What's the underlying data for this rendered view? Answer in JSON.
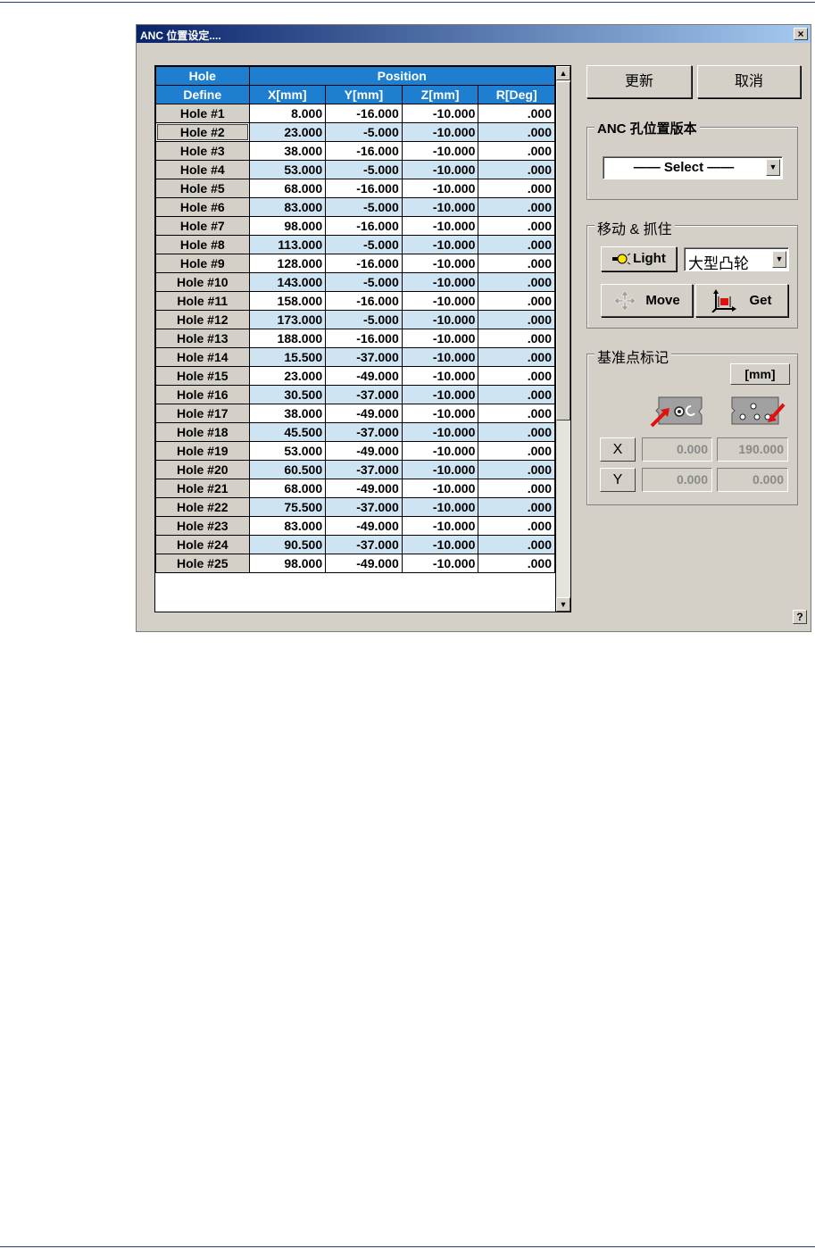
{
  "window": {
    "title": "ANC 位置设定....",
    "close_glyph": "×"
  },
  "grid": {
    "header_top": {
      "hole": "Hole",
      "position": "Position"
    },
    "header_cols": [
      "Define",
      "X[mm]",
      "Y[mm]",
      "Z[mm]",
      "R[Deg]"
    ],
    "rows": [
      [
        "Hole #1",
        "8.000",
        "-16.000",
        "-10.000",
        ".000"
      ],
      [
        "Hole #2",
        "23.000",
        "-5.000",
        "-10.000",
        ".000"
      ],
      [
        "Hole #3",
        "38.000",
        "-16.000",
        "-10.000",
        ".000"
      ],
      [
        "Hole #4",
        "53.000",
        "-5.000",
        "-10.000",
        ".000"
      ],
      [
        "Hole #5",
        "68.000",
        "-16.000",
        "-10.000",
        ".000"
      ],
      [
        "Hole #6",
        "83.000",
        "-5.000",
        "-10.000",
        ".000"
      ],
      [
        "Hole #7",
        "98.000",
        "-16.000",
        "-10.000",
        ".000"
      ],
      [
        "Hole #8",
        "113.000",
        "-5.000",
        "-10.000",
        ".000"
      ],
      [
        "Hole #9",
        "128.000",
        "-16.000",
        "-10.000",
        ".000"
      ],
      [
        "Hole #10",
        "143.000",
        "-5.000",
        "-10.000",
        ".000"
      ],
      [
        "Hole #11",
        "158.000",
        "-16.000",
        "-10.000",
        ".000"
      ],
      [
        "Hole #12",
        "173.000",
        "-5.000",
        "-10.000",
        ".000"
      ],
      [
        "Hole #13",
        "188.000",
        "-16.000",
        "-10.000",
        ".000"
      ],
      [
        "Hole #14",
        "15.500",
        "-37.000",
        "-10.000",
        ".000"
      ],
      [
        "Hole #15",
        "23.000",
        "-49.000",
        "-10.000",
        ".000"
      ],
      [
        "Hole #16",
        "30.500",
        "-37.000",
        "-10.000",
        ".000"
      ],
      [
        "Hole #17",
        "38.000",
        "-49.000",
        "-10.000",
        ".000"
      ],
      [
        "Hole #18",
        "45.500",
        "-37.000",
        "-10.000",
        ".000"
      ],
      [
        "Hole #19",
        "53.000",
        "-49.000",
        "-10.000",
        ".000"
      ],
      [
        "Hole #20",
        "60.500",
        "-37.000",
        "-10.000",
        ".000"
      ],
      [
        "Hole #21",
        "68.000",
        "-49.000",
        "-10.000",
        ".000"
      ],
      [
        "Hole #22",
        "75.500",
        "-37.000",
        "-10.000",
        ".000"
      ],
      [
        "Hole #23",
        "83.000",
        "-49.000",
        "-10.000",
        ".000"
      ],
      [
        "Hole #24",
        "90.500",
        "-37.000",
        "-10.000",
        ".000"
      ],
      [
        "Hole #25",
        "98.000",
        "-49.000",
        "-10.000",
        ".000"
      ]
    ],
    "selected_row": "Hole #2"
  },
  "buttons": {
    "update": "更新",
    "cancel": "取消"
  },
  "version_group": {
    "legend": "ANC 孔位置版本",
    "select_value": "—— Select ——"
  },
  "move_group": {
    "legend": "移动 & 抓住",
    "light_label": "Light",
    "cam_select_value": "大型凸轮",
    "move_label": "Move",
    "get_label": "Get"
  },
  "ref_group": {
    "legend": "基准点标记",
    "unit": "[mm]",
    "x_label": "X",
    "y_label": "Y",
    "x1": "0.000",
    "x2": "190.000",
    "y1": "0.000",
    "y2": "0.000"
  },
  "help_glyph": "?",
  "colors": {
    "grid_header": "#1e7fd0",
    "row_alt": "#cfe4f2",
    "title_start": "#0a246a",
    "title_end": "#a6caf0"
  }
}
